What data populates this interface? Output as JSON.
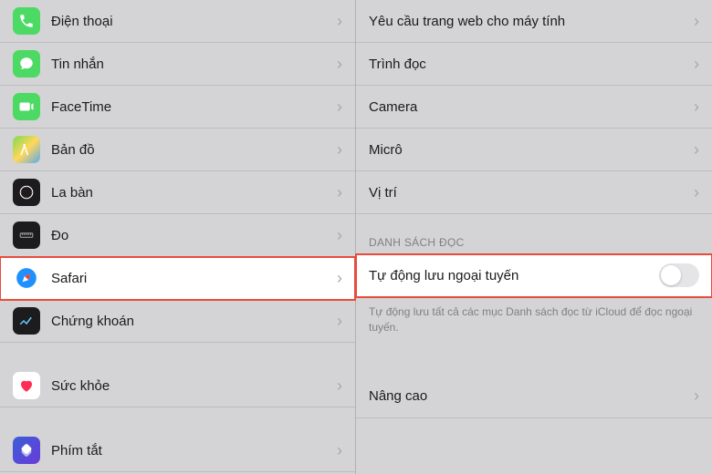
{
  "left": {
    "items": [
      {
        "label": "Điện thoại",
        "icon": "phone"
      },
      {
        "label": "Tin nhắn",
        "icon": "message"
      },
      {
        "label": "FaceTime",
        "icon": "facetime"
      },
      {
        "label": "Bản đồ",
        "icon": "maps"
      },
      {
        "label": "La bàn",
        "icon": "compass"
      },
      {
        "label": "Đo",
        "icon": "measure"
      },
      {
        "label": "Safari",
        "icon": "safari",
        "selected": true
      },
      {
        "label": "Chứng khoán",
        "icon": "stocks"
      },
      {
        "label": "Sức khỏe",
        "icon": "health"
      },
      {
        "label": "Phím tắt",
        "icon": "shortcuts"
      }
    ]
  },
  "right": {
    "topItems": [
      {
        "label": "Yêu cầu trang web cho máy tính"
      },
      {
        "label": "Trình đọc"
      },
      {
        "label": "Camera"
      },
      {
        "label": "Micrô"
      },
      {
        "label": "Vị trí"
      }
    ],
    "sectionHeader": "DANH SÁCH ĐỌC",
    "toggleItem": {
      "label": "Tự động lưu ngoại tuyến",
      "on": false,
      "highlighted": true
    },
    "sectionFooter": "Tự động lưu tất cả các mục Danh sách đọc từ iCloud để đọc ngoại tuyến.",
    "bottomItem": {
      "label": "Nâng cao"
    }
  }
}
